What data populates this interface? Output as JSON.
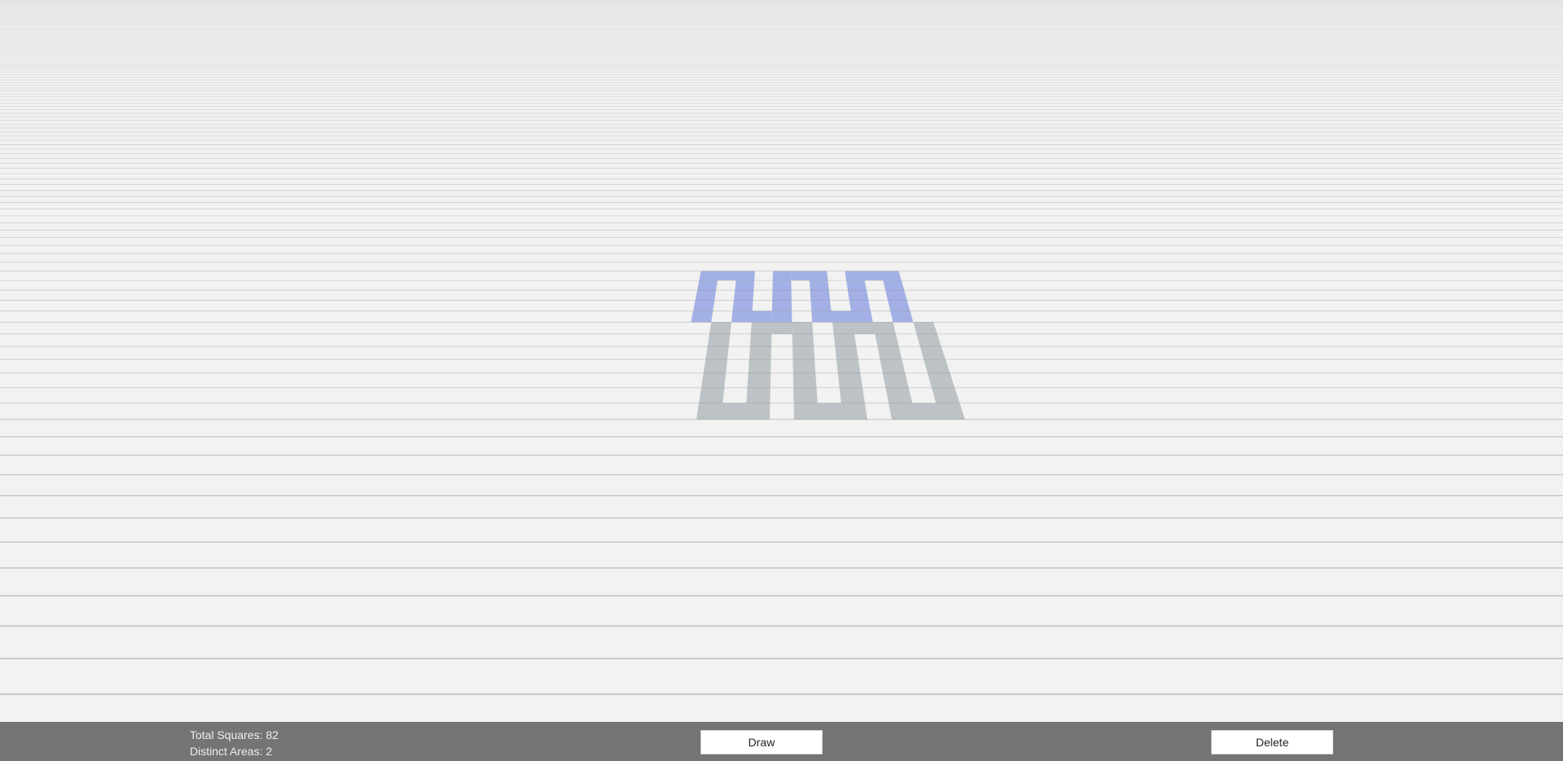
{
  "scene": {
    "background_color": "#f1f2f1",
    "grid_line_color": "#8f9390",
    "colors": {
      "placed": "#b6bcc0",
      "selected": "#9eacE4"
    },
    "areas": [
      {
        "state": "placed",
        "color_key": "placed",
        "cells": [
          [
            -3,
            -7
          ],
          [
            -2,
            -7
          ],
          [
            -1,
            -7
          ],
          [
            1,
            -7
          ],
          [
            2,
            -7
          ],
          [
            3,
            -7
          ],
          [
            5,
            -7
          ],
          [
            6,
            -7
          ],
          [
            7,
            -7
          ],
          [
            -3,
            -6
          ],
          [
            -1,
            -6
          ],
          [
            1,
            -6
          ],
          [
            3,
            -6
          ],
          [
            5,
            -6
          ],
          [
            7,
            -6
          ],
          [
            -3,
            -5
          ],
          [
            -1,
            -5
          ],
          [
            1,
            -5
          ],
          [
            3,
            -5
          ],
          [
            5,
            -5
          ],
          [
            7,
            -5
          ],
          [
            -3,
            -4
          ],
          [
            -1,
            -4
          ],
          [
            1,
            -4
          ],
          [
            3,
            -4
          ],
          [
            5,
            -4
          ],
          [
            7,
            -4
          ],
          [
            -3,
            -3
          ],
          [
            -1,
            -3
          ],
          [
            1,
            -3
          ],
          [
            3,
            -3
          ],
          [
            5,
            -3
          ],
          [
            7,
            -3
          ],
          [
            -3,
            -2
          ],
          [
            -1,
            -2
          ],
          [
            1,
            -2
          ],
          [
            3,
            -2
          ],
          [
            5,
            -2
          ],
          [
            7,
            -2
          ],
          [
            -3,
            -1
          ],
          [
            -1,
            -1
          ],
          [
            0,
            -1
          ],
          [
            1,
            -1
          ],
          [
            3,
            -1
          ],
          [
            4,
            -1
          ],
          [
            5,
            -1
          ],
          [
            7,
            -1
          ]
        ]
      },
      {
        "state": "selected",
        "color_key": "selected",
        "cells": [
          [
            -4,
            0
          ],
          [
            -2,
            0
          ],
          [
            -1,
            0
          ],
          [
            0,
            0
          ],
          [
            2,
            0
          ],
          [
            3,
            0
          ],
          [
            4,
            0
          ],
          [
            6,
            0
          ],
          [
            -4,
            1
          ],
          [
            -2,
            1
          ],
          [
            0,
            1
          ],
          [
            2,
            1
          ],
          [
            4,
            1
          ],
          [
            6,
            1
          ],
          [
            -4,
            2
          ],
          [
            -2,
            2
          ],
          [
            0,
            2
          ],
          [
            2,
            2
          ],
          [
            4,
            2
          ],
          [
            6,
            2
          ],
          [
            -4,
            3
          ],
          [
            -2,
            3
          ],
          [
            0,
            3
          ],
          [
            2,
            3
          ],
          [
            4,
            3
          ],
          [
            6,
            3
          ],
          [
            -4,
            4
          ],
          [
            -3,
            4
          ],
          [
            -2,
            4
          ],
          [
            0,
            4
          ],
          [
            1,
            4
          ],
          [
            2,
            4
          ],
          [
            4,
            4
          ],
          [
            5,
            4
          ],
          [
            6,
            4
          ]
        ]
      }
    ]
  },
  "stats": {
    "total_label": "Total Squares: 82",
    "areas_label": "Distinct Areas: 2"
  },
  "toolbar": {
    "draw_label": "Draw",
    "delete_label": "Delete"
  }
}
